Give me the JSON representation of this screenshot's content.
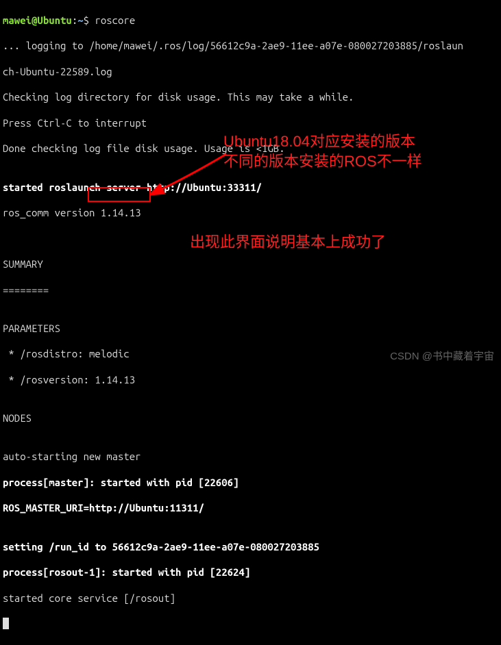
{
  "prompt": {
    "user": "mawei",
    "host": "Ubuntu",
    "path": "~",
    "symbol": "$",
    "command": "roscore"
  },
  "output": {
    "l1": "... logging to /home/mawei/.ros/log/56612c9a-2ae9-11ee-a07e-080027203885/roslaun",
    "l2": "ch-Ubuntu-22589.log",
    "l3": "Checking log directory for disk usage. This may take a while.",
    "l4": "Press Ctrl-C to interrupt",
    "l5": "Done checking log file disk usage. Usage is <1GB.",
    "l6": "",
    "l7": "started roslaunch server http://Ubuntu:33311/",
    "l8": "ros_comm version 1.14.13",
    "l9": "",
    "l10": "",
    "l11": "SUMMARY",
    "l12": "========",
    "l13": "",
    "l14": "PARAMETERS",
    "l15a": " * /rosdistro: ",
    "l15b": "melodic",
    "l16": " * /rosversion: 1.14.13",
    "l17": "",
    "l18": "NODES",
    "l19": "",
    "l20": "auto-starting new master",
    "l21": "process[master]: started with pid [22606]",
    "l22": "ROS_MASTER_URI=http://Ubuntu:11311/",
    "l23": "",
    "l24": "setting /run_id to 56612c9a-2ae9-11ee-a07e-080027203885",
    "l25": "process[rosout-1]: started with pid [22624]",
    "l26": "started core service [/rosout]"
  },
  "annotations": {
    "note1_line1": "Ubuntu18.04对应安装的版本",
    "note1_line2": "不同的版本安装的ROS不一样",
    "note2": "出现此界面说明基本上成功了"
  },
  "watermark": "CSDN @书中藏着宇宙"
}
